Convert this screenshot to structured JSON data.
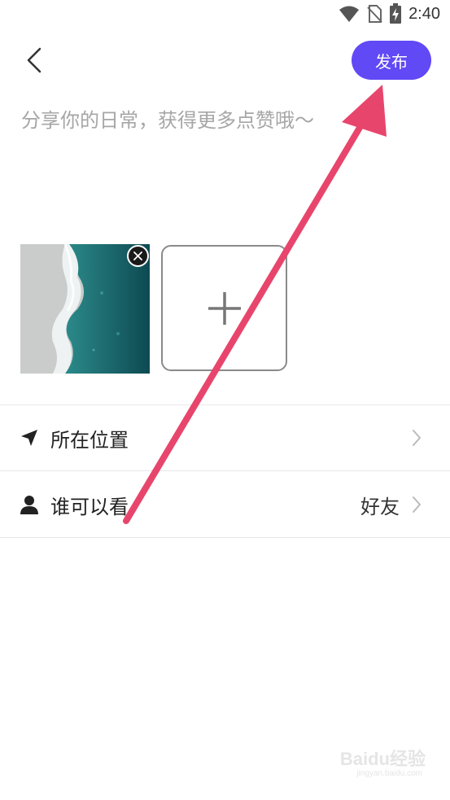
{
  "status_bar": {
    "time": "2:40",
    "icons": [
      "wifi-icon",
      "no-sim-icon",
      "battery-charging-icon"
    ]
  },
  "header": {
    "back_icon": "chevron-left-icon",
    "publish_label": "发布"
  },
  "composer": {
    "placeholder": "分享你的日常，获得更多点赞哦～",
    "value": ""
  },
  "media": {
    "remove_icon": "close-icon",
    "add_icon": "plus-icon"
  },
  "options": [
    {
      "icon": "location-arrow-icon",
      "label": "所在位置",
      "value": "",
      "chevron": "chevron-right-icon"
    },
    {
      "icon": "person-icon",
      "label": "谁可以看",
      "value": "好友",
      "chevron": "chevron-right-icon"
    }
  ],
  "colors": {
    "accent": "#6149f5",
    "annotation_arrow": "#e8456d"
  },
  "watermark": {
    "brand": "Baidu经验",
    "url": "jingyan.baidu.com"
  }
}
